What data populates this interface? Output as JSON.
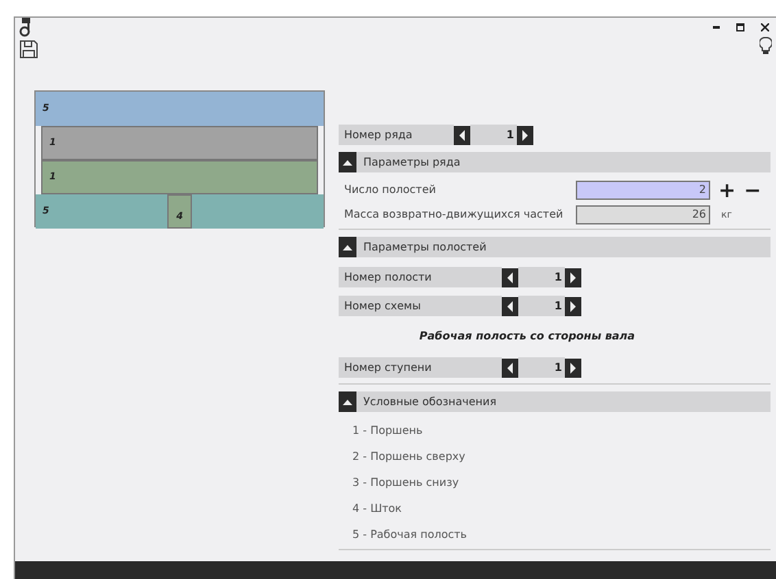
{
  "diagram": {
    "layers": [
      {
        "label": "5",
        "color": "#94b4d4",
        "kind": "full"
      },
      {
        "label": "1",
        "color": "#a2a2a2",
        "kind": "inset"
      },
      {
        "label": "1",
        "color": "#8fa98a",
        "kind": "inset"
      },
      {
        "label": "5",
        "color": "#7fb2b0",
        "kind": "rod",
        "rod_label": "4"
      }
    ]
  },
  "row_stepper": {
    "label": "Номер ряда",
    "value": "1"
  },
  "sections": [
    {
      "title": "Параметры ряда",
      "expanded": true,
      "rows": [
        {
          "kind": "input",
          "label": "Число полостей",
          "value": "2",
          "focused": true,
          "plus": "+",
          "minus": "−"
        },
        {
          "kind": "input",
          "label": "Масса возвратно-движущихся частей",
          "value": "26",
          "focused": false,
          "unit": "кг"
        }
      ]
    },
    {
      "title": "Параметры полостей",
      "expanded": true,
      "rows": [
        {
          "kind": "stepper",
          "label": "Номер полости",
          "value": "1"
        },
        {
          "kind": "stepper",
          "label": "Номер схемы",
          "value": "1"
        },
        {
          "kind": "caption",
          "label": "Рабочая полость со стороны вала"
        },
        {
          "kind": "stepper",
          "label": "Номер ступени",
          "value": "1"
        }
      ]
    },
    {
      "title": "Условные обозначения",
      "expanded": true,
      "rows": [
        {
          "kind": "legend",
          "label": "1 - Поршень"
        },
        {
          "kind": "legend",
          "label": "2 - Поршень сверху"
        },
        {
          "kind": "legend",
          "label": "3 - Поршень снизу"
        },
        {
          "kind": "legend",
          "label": "4 - Шток"
        },
        {
          "kind": "legend",
          "label": "5 - Рабочая полость"
        }
      ]
    }
  ]
}
